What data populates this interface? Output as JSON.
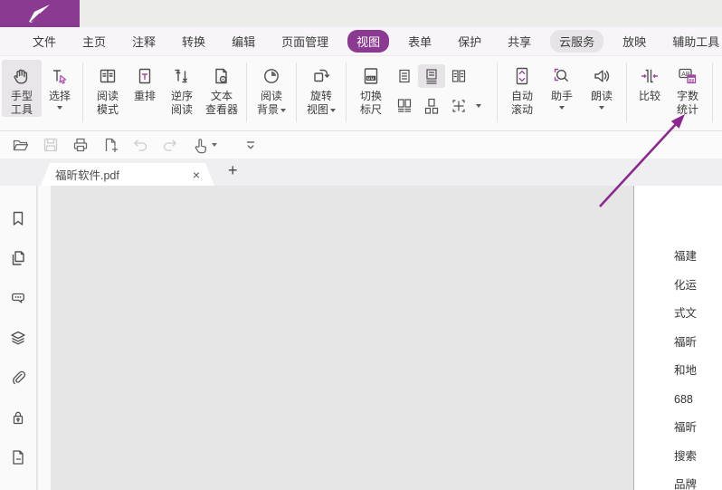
{
  "window": {
    "brand_color": "#8b3a92",
    "logo_icon": "quill-pen"
  },
  "menu": {
    "items": [
      {
        "label": "文件"
      },
      {
        "label": "主页"
      },
      {
        "label": "注释"
      },
      {
        "label": "转换"
      },
      {
        "label": "编辑"
      },
      {
        "label": "页面管理"
      },
      {
        "label": "视图",
        "state": "active"
      },
      {
        "label": "表单"
      },
      {
        "label": "保护"
      },
      {
        "label": "共享"
      },
      {
        "label": "云服务",
        "state": "highlighted"
      },
      {
        "label": "放映"
      },
      {
        "label": "辅助工具"
      }
    ]
  },
  "ribbon": {
    "buttons": [
      {
        "id": "hand-tool",
        "line1": "手型",
        "line2": "工具",
        "selected": true
      },
      {
        "id": "select",
        "line1": "选择",
        "dropdown": true
      },
      {
        "id": "reading-mode",
        "line1": "阅读",
        "line2": "模式"
      },
      {
        "id": "reflow",
        "line1": "重排"
      },
      {
        "id": "reverse-reading",
        "line1": "逆序",
        "line2": "阅读"
      },
      {
        "id": "text-viewer",
        "line1": "文本",
        "line2": "查看器"
      },
      {
        "id": "reading-background",
        "line1": "阅读",
        "line2": "背景",
        "dropdown": true
      },
      {
        "id": "rotate-view",
        "line1": "旋转",
        "line2": "视图",
        "dropdown": true
      },
      {
        "id": "toggle-ruler",
        "line1": "切换",
        "line2": "标尺"
      },
      {
        "id": "auto-scroll",
        "line1": "自动",
        "line2": "滚动"
      },
      {
        "id": "assistant",
        "line1": "助手",
        "dropdown": true
      },
      {
        "id": "read-aloud",
        "line1": "朗读",
        "dropdown": true
      },
      {
        "id": "compare",
        "line1": "比较"
      },
      {
        "id": "word-count",
        "line1": "字数",
        "line2": "统计"
      }
    ],
    "page_layout": {
      "icons": [
        "single-page",
        "continuous-page",
        "facing-pages",
        "facing-continuous",
        "separate-cover",
        "split-view"
      ],
      "selected": "continuous-page",
      "dropdown": true
    }
  },
  "quickbar": {
    "buttons": [
      {
        "icon": "open-folder",
        "disabled": false
      },
      {
        "icon": "save",
        "disabled": true
      },
      {
        "icon": "print",
        "disabled": false
      },
      {
        "icon": "new-document",
        "disabled": false
      },
      {
        "icon": "undo",
        "disabled": true
      },
      {
        "icon": "redo",
        "disabled": true
      },
      {
        "icon": "hand-mode",
        "disabled": false,
        "dropdown": true
      },
      {
        "icon": "customize-toolbar",
        "disabled": false
      }
    ]
  },
  "tabbar": {
    "active_tab": "福昕软件.pdf",
    "close_glyph": "×",
    "new_tab_glyph": "+"
  },
  "sidebar": {
    "icons": [
      "bookmarks",
      "page-thumbnails",
      "comments",
      "layers",
      "attachments",
      "security",
      "file-annotations"
    ]
  },
  "document": {
    "page_lines": [
      "福建",
      "化运",
      "式文",
      "福昕",
      "和地",
      "688",
      "福昕",
      "搜索",
      "品牌"
    ]
  },
  "annotation": {
    "arrow_color": "#8b2a8e",
    "arrow_points_to": "word-count-button"
  },
  "colors": {
    "accent": "#8b3a92",
    "menu_active_bg": "#8b3a92",
    "menu_highlight_bg": "#e6e4e6",
    "canvas": "#e7e6e7",
    "selected_button_bg": "#e8e6e8"
  }
}
